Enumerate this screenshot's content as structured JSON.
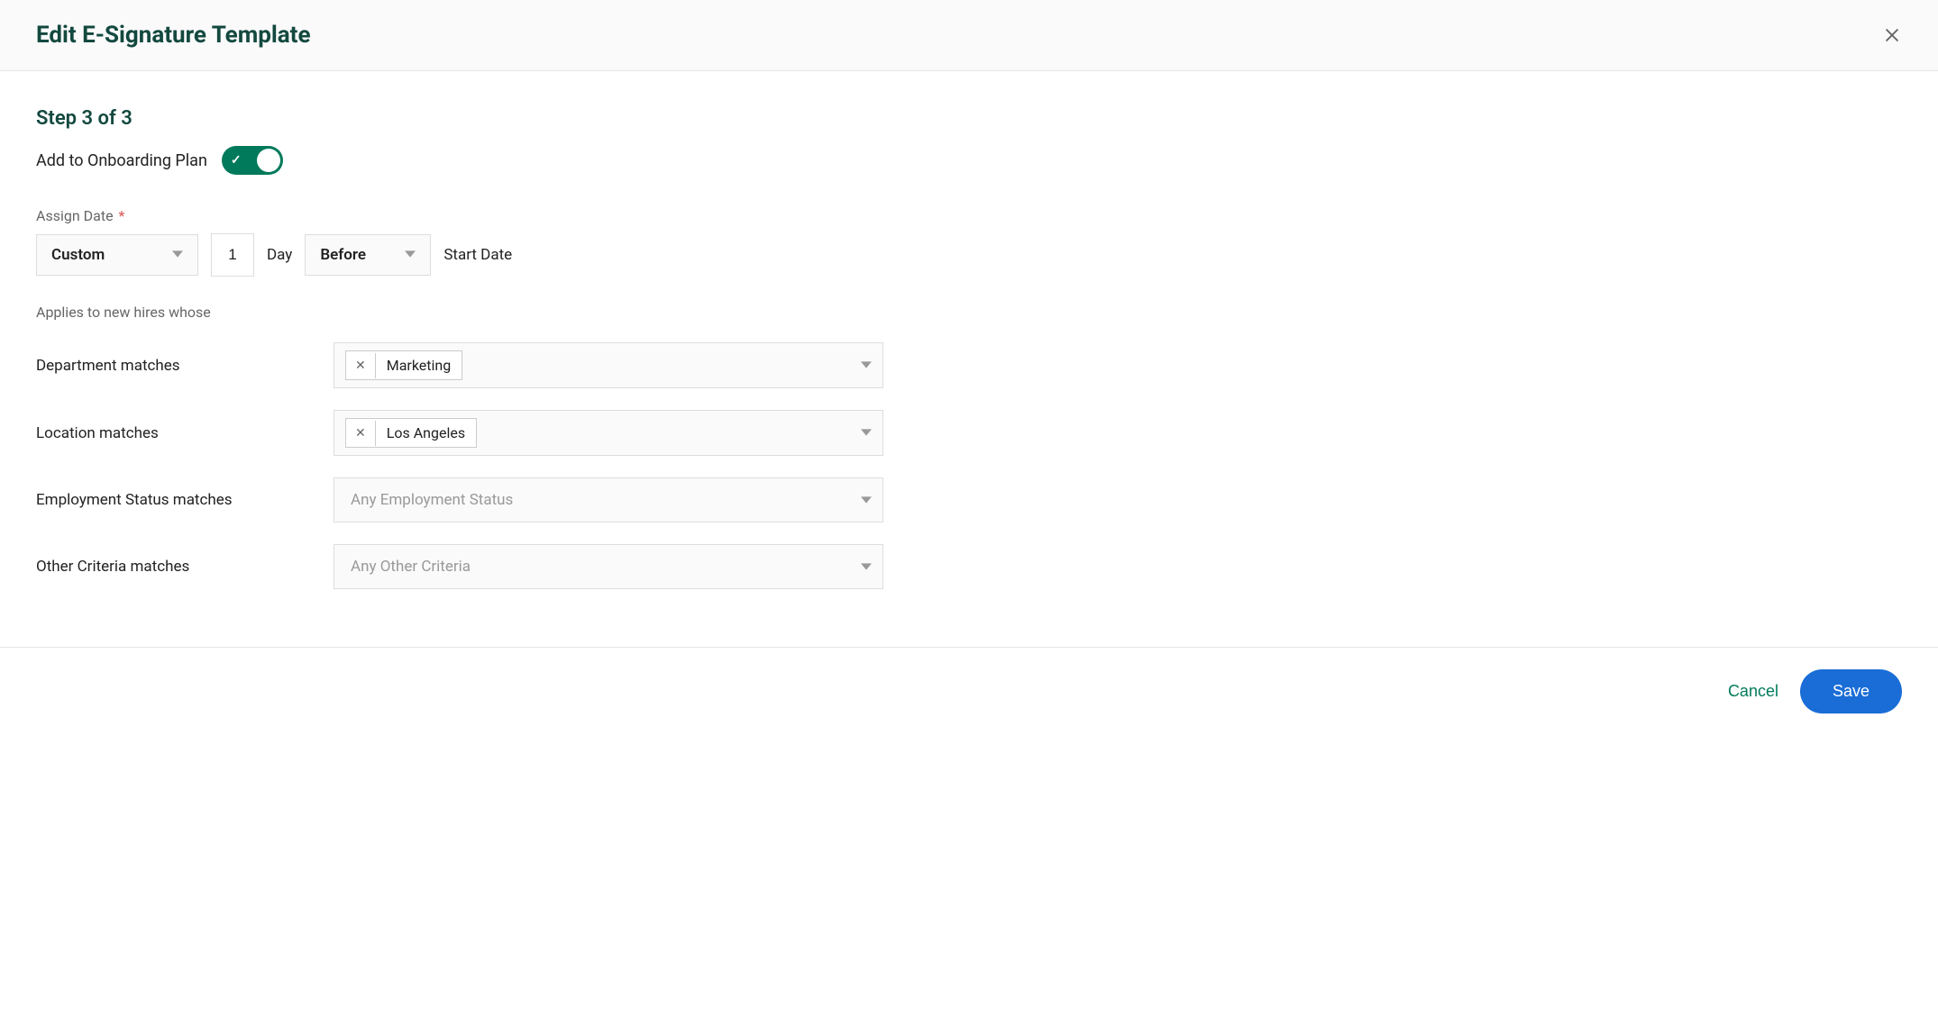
{
  "header": {
    "title": "Edit E-Signature Template"
  },
  "step": {
    "label": "Step 3 of 3"
  },
  "toggle": {
    "label": "Add to Onboarding Plan",
    "enabled": true
  },
  "assignDate": {
    "label": "Assign Date",
    "required": "*",
    "modeSelect": "Custom",
    "dayValue": "1",
    "dayUnit": "Day",
    "relationSelect": "Before",
    "referenceLabel": "Start Date"
  },
  "appliesTo": {
    "sectionLabel": "Applies to new hires whose",
    "rows": {
      "department": {
        "label": "Department matches",
        "chip": "Marketing"
      },
      "location": {
        "label": "Location matches",
        "chip": "Los Angeles"
      },
      "employmentStatus": {
        "label": "Employment Status matches",
        "placeholder": "Any Employment Status"
      },
      "otherCriteria": {
        "label": "Other Criteria matches",
        "placeholder": "Any Other Criteria"
      }
    }
  },
  "footer": {
    "cancel": "Cancel",
    "save": "Save"
  }
}
